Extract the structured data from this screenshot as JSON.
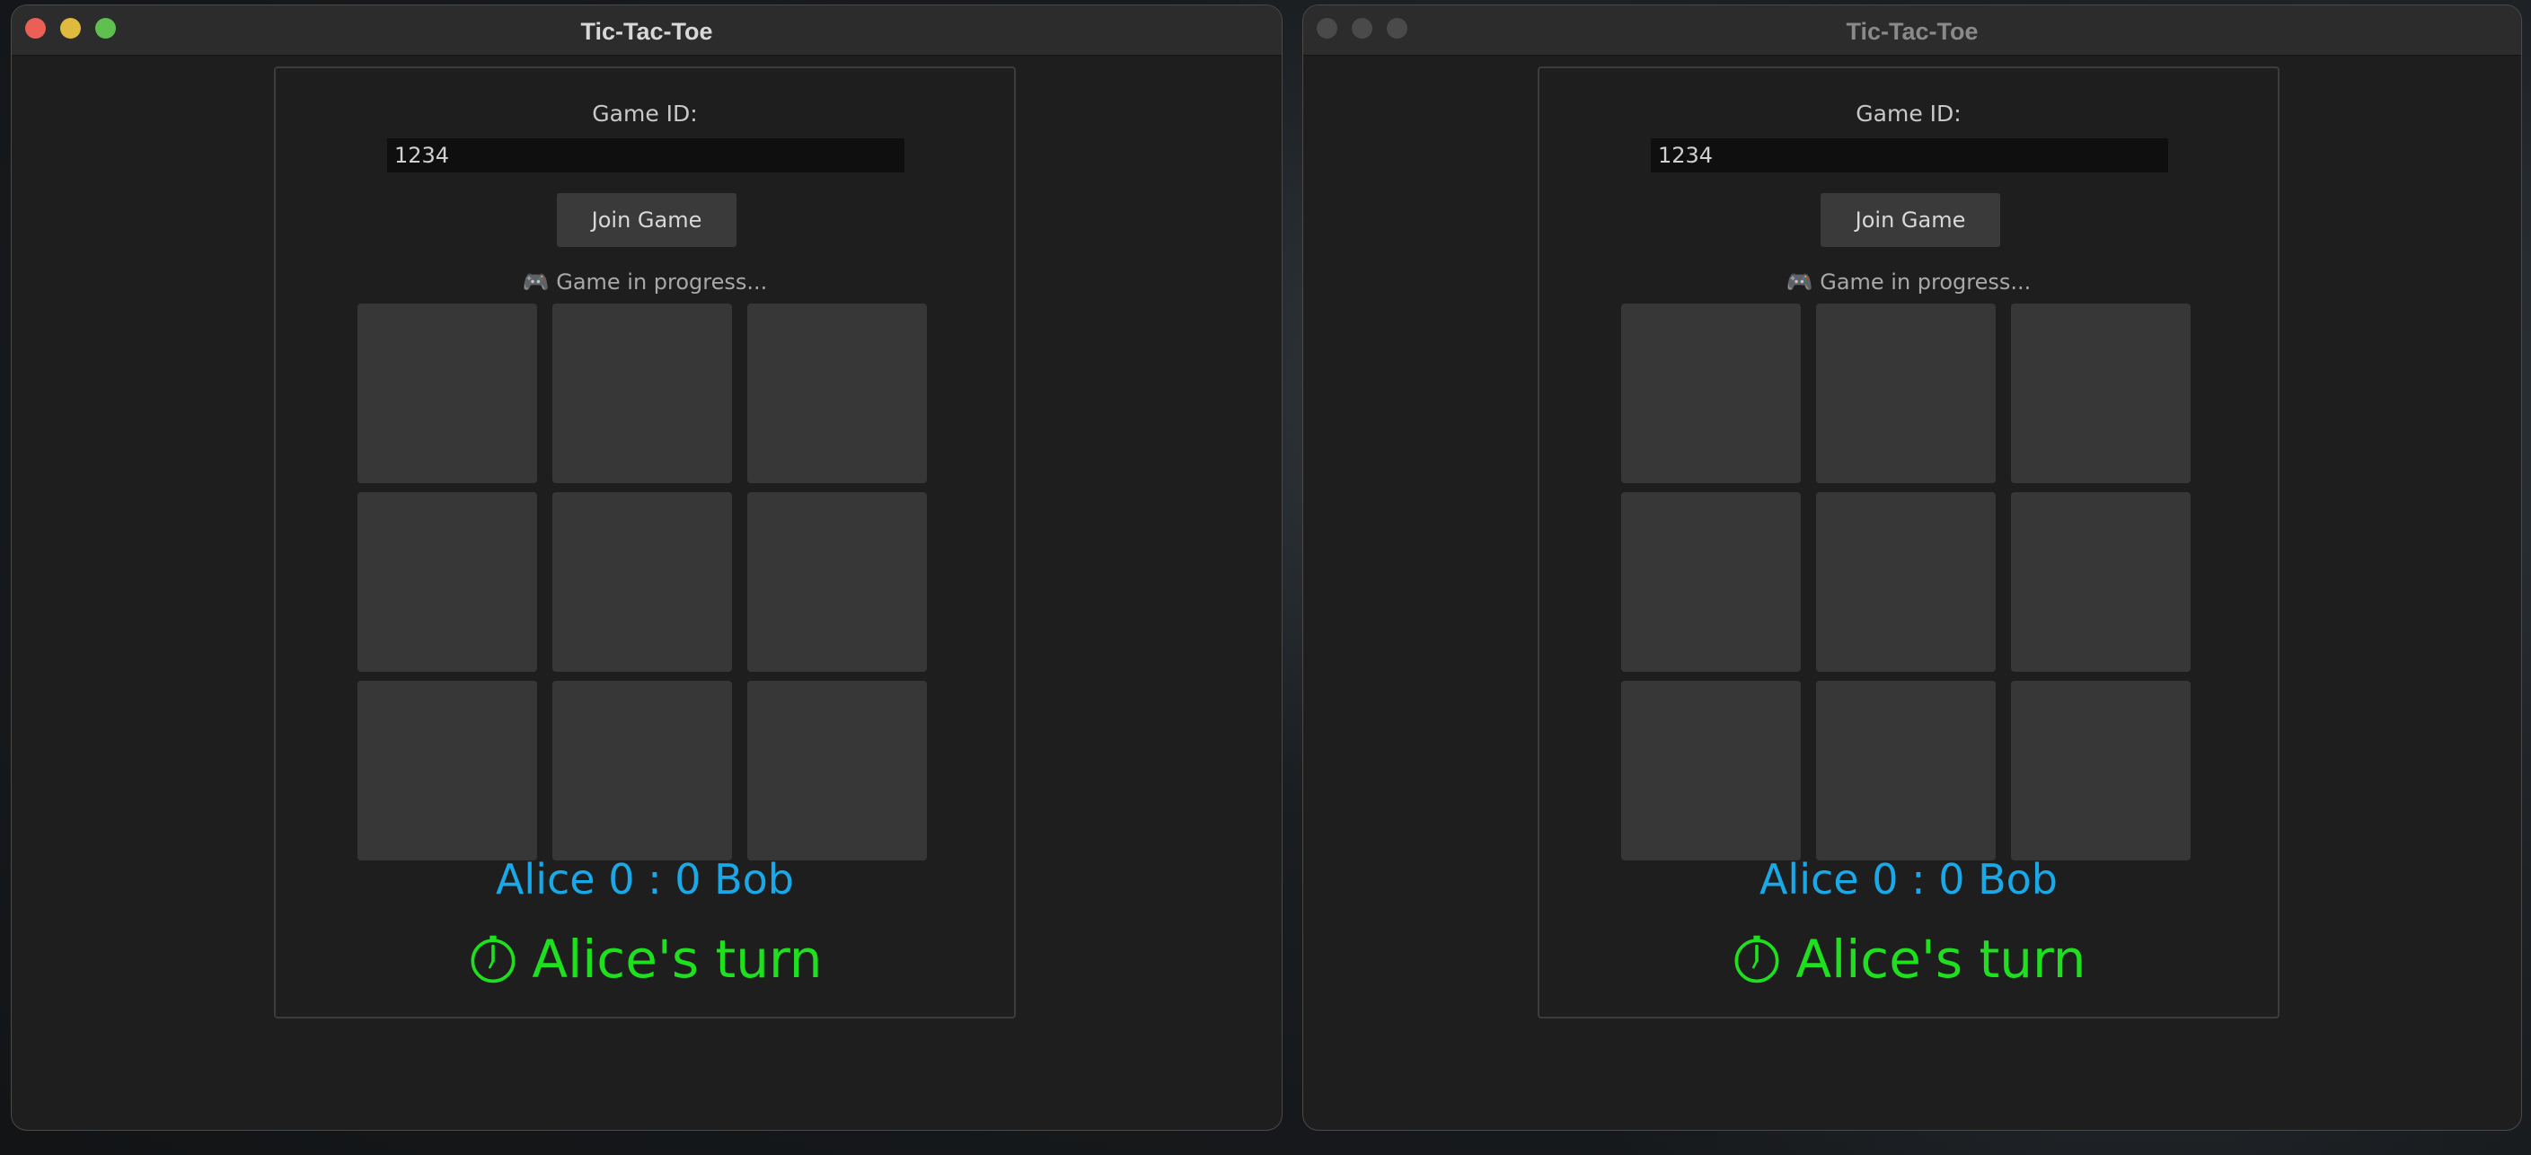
{
  "windows": [
    {
      "title": "Tic-Tac-Toe",
      "active": true,
      "game_id_label": "Game ID:",
      "game_id_value": "1234",
      "join_button_label": "Join Game",
      "status_icon": "gamepad-icon",
      "status_text": "🎮 Game in progress...",
      "board": [
        "",
        "",
        "",
        "",
        "",
        "",
        "",
        "",
        ""
      ],
      "score_text": "Alice 0 : 0 Bob",
      "turn_icon": "stopwatch-icon",
      "turn_text": "Alice's turn"
    },
    {
      "title": "Tic-Tac-Toe",
      "active": false,
      "game_id_label": "Game ID:",
      "game_id_value": "1234",
      "join_button_label": "Join Game",
      "status_icon": "gamepad-icon",
      "status_text": "🎮 Game in progress...",
      "board": [
        "",
        "",
        "",
        "",
        "",
        "",
        "",
        "",
        ""
      ],
      "score_text": "Alice 0 : 0 Bob",
      "turn_icon": "stopwatch-icon",
      "turn_text": "Alice's turn"
    }
  ],
  "colors": {
    "score": "#1aa9e8",
    "turn": "#1fe01f",
    "close": "#ec5f57",
    "minimize": "#e0ba3f",
    "zoom": "#5fc04f"
  }
}
